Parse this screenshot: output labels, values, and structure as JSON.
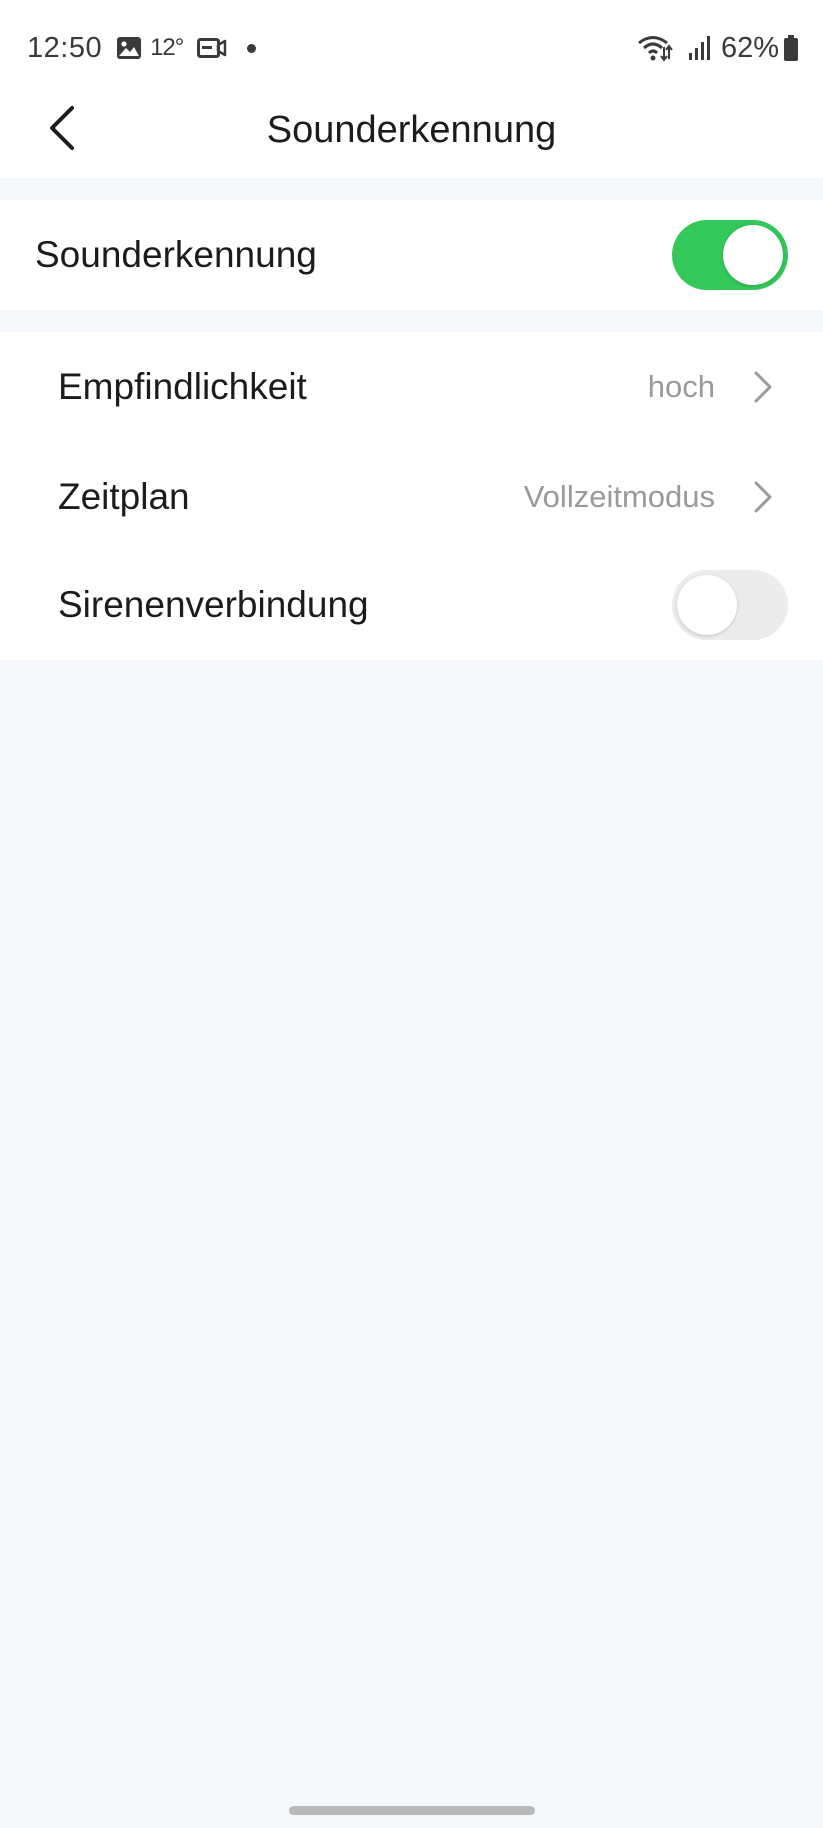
{
  "status_bar": {
    "time": "12:50",
    "temperature": "12°",
    "battery": "62%",
    "icons": [
      "gallery-icon",
      "video-camera-icon",
      "notification-dot",
      "wifi-calling-icon",
      "signal-icon",
      "battery-icon"
    ]
  },
  "header": {
    "title": "Sounderkennung",
    "back_icon": "chevron-left-icon"
  },
  "main_toggle": {
    "label": "Sounderkennung",
    "enabled": true,
    "on_color": "#34c759"
  },
  "settings": [
    {
      "label": "Empfindlichkeit",
      "value": "hoch",
      "type": "link"
    },
    {
      "label": "Zeitplan",
      "value": "Vollzeitmodus",
      "type": "link"
    },
    {
      "label": "Sirenenverbindung",
      "type": "toggle",
      "enabled": false
    }
  ],
  "colors": {
    "background": "#f4f7fc",
    "card": "#ffffff",
    "secondary_text": "#9a9a9a"
  }
}
